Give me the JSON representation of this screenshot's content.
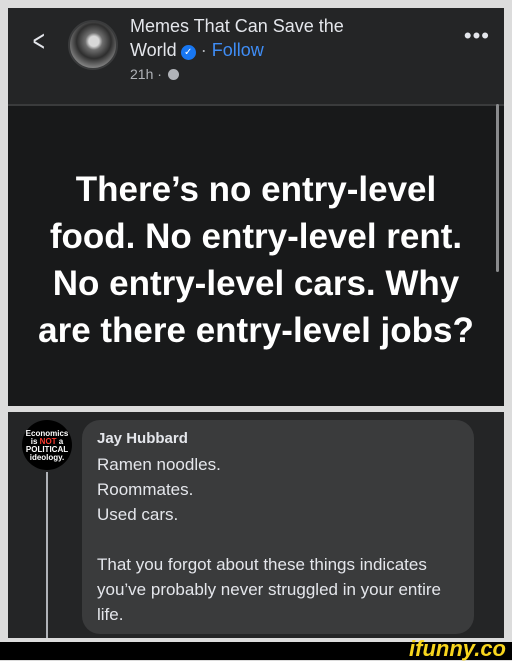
{
  "post": {
    "author_name_line1": "Memes That Can Save the",
    "author_name_line2": "World",
    "verified_icon": "verified-badge-icon",
    "separator": "·",
    "follow_label": "Follow",
    "timestamp": "21h ·",
    "headline": "There’s no entry-level food. No entry-level rent. No entry-level cars. Why are there entry-level jobs?"
  },
  "comment": {
    "avatar_text": {
      "line1": "Economics",
      "line2_prefix": "is ",
      "line2_emph": "NOT",
      "line2_suffix": " a",
      "line3": "POLITICAL",
      "line4": "ideology."
    },
    "author": "Jay Hubbard",
    "text": "Ramen noodles.\nRoommates.\nUsed cars.\n\nThat you forgot about these things indicates you’ve probably never struggled in your entire life."
  },
  "watermark": "ifunny.co",
  "colors": {
    "accent": "#3f8df5",
    "watermark": "#f7d51d",
    "verified": "#1877f2"
  }
}
